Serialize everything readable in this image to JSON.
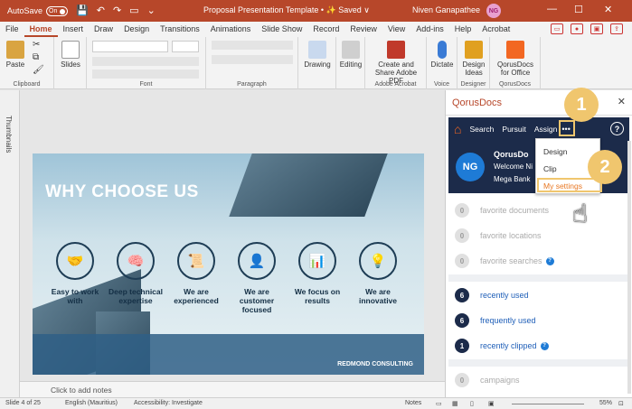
{
  "titlebar": {
    "autosave": "AutoSave",
    "autosave_state": "On",
    "doc_title": "Proposal Presentation Template • ✨ Saved ∨",
    "user": "Niven Ganapathee",
    "user_initials": "NG"
  },
  "menu": [
    "File",
    "Home",
    "Insert",
    "Draw",
    "Design",
    "Transitions",
    "Animations",
    "Slide Show",
    "Record",
    "Review",
    "View",
    "Add-ins",
    "Help",
    "Acrobat"
  ],
  "ribbon": {
    "clipboard": "Clipboard",
    "paste": "Paste",
    "slides": "Slides",
    "font": "Font",
    "paragraph": "Paragraph",
    "drawing": "Drawing",
    "editing": "Editing",
    "create_share_pdf": "Create and Share Adobe PDF",
    "adobe_acrobat": "Adobe Acrobat",
    "dictate": "Dictate",
    "voice": "Voice",
    "design_ideas": "Design Ideas",
    "designer": "Designer",
    "qorus_office": "QorusDocs for Office",
    "qorusdocs_group": "QorusDocs"
  },
  "thumbnails_label": "Thumbnails",
  "slide": {
    "title": "WHY CHOOSE US",
    "items": [
      {
        "icon": "handshake-icon",
        "glyph": "🤝",
        "label": "Easy to work with"
      },
      {
        "icon": "brain-icon",
        "glyph": "🧠",
        "label": "Deep technical expertise"
      },
      {
        "icon": "scroll-icon",
        "glyph": "📜",
        "label": "We are experienced"
      },
      {
        "icon": "person-icon",
        "glyph": "👤",
        "label": "We are customer focused"
      },
      {
        "icon": "bar-chart-icon",
        "glyph": "📊",
        "label": "We focus on results"
      },
      {
        "icon": "lightbulb-icon",
        "glyph": "💡",
        "label": "We are innovative"
      }
    ],
    "brand": "REDMOND CONSULTING"
  },
  "notes_placeholder": "Click to add notes",
  "status": {
    "slide": "Slide 4 of 25",
    "language": "English (Mauritius)",
    "accessibility": "Accessibility: Investigate",
    "notes": "Notes",
    "zoom": "55%"
  },
  "pane": {
    "title": "QorusDocs",
    "nav": {
      "search": "Search",
      "pursuit": "Pursuit",
      "assign": "Assign",
      "more": "•••",
      "help": "?"
    },
    "card": {
      "initials": "NG",
      "brand": "QorusDo",
      "welcome": "Welcome Ni",
      "client": "Mega Bank"
    },
    "dropdown": [
      "Design",
      "Clip",
      "My settings"
    ],
    "steps": [
      "1",
      "2"
    ],
    "items": [
      {
        "count": "0",
        "label": "favorite documents",
        "style": "grey"
      },
      {
        "count": "0",
        "label": "favorite locations",
        "style": "grey"
      },
      {
        "count": "0",
        "label": "favorite searches",
        "style": "grey",
        "help": "?"
      },
      {
        "count": "6",
        "label": "recently used",
        "style": "dark"
      },
      {
        "count": "6",
        "label": "frequently used",
        "style": "dark"
      },
      {
        "count": "1",
        "label": "recently clipped",
        "style": "dark",
        "help": "?"
      },
      {
        "count": "0",
        "label": "campaigns",
        "style": "grey"
      }
    ]
  },
  "colors": {
    "accent": "#b7472a",
    "navy": "#1c2b4a",
    "highlight": "#f0c66e",
    "link": "#1f5fb8"
  }
}
